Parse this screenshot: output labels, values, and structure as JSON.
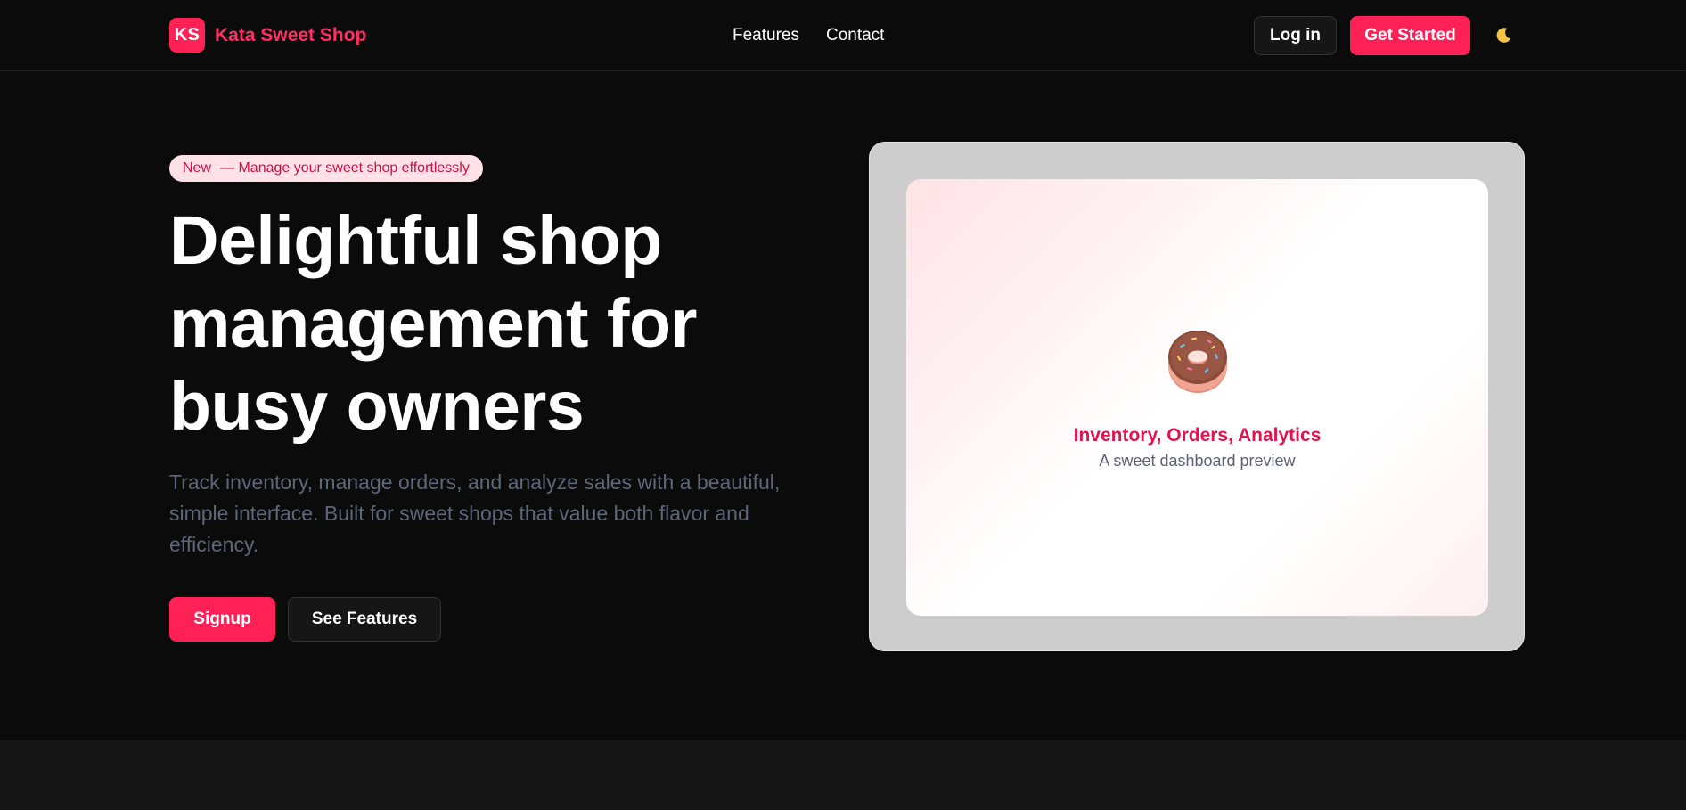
{
  "brand": {
    "logo_text": "KS",
    "name": "Kata Sweet Shop"
  },
  "nav": {
    "links": [
      {
        "label": "Features"
      },
      {
        "label": "Contact"
      }
    ]
  },
  "header_actions": {
    "login": "Log in",
    "get_started": "Get Started",
    "theme_icon": "moon-icon"
  },
  "hero": {
    "badge": {
      "tag": "New",
      "text": "— Manage your sweet shop effortlessly"
    },
    "title_lines": [
      "Delightful shop",
      "management for",
      "busy owners"
    ],
    "description": "Track inventory, manage orders, and analyze sales with a beautiful, simple interface. Built for sweet shops that value both flavor and efficiency.",
    "primary_button": "Signup",
    "secondary_button": "See Features"
  },
  "preview": {
    "icon": "donut-icon",
    "title": "Inventory, Orders, Analytics",
    "subtitle": "A sweet dashboard preview"
  },
  "colors": {
    "accent": "#ff2156",
    "brand_text": "#ff2e63",
    "background": "#0b0b0b",
    "muted_text": "#5e6678"
  }
}
